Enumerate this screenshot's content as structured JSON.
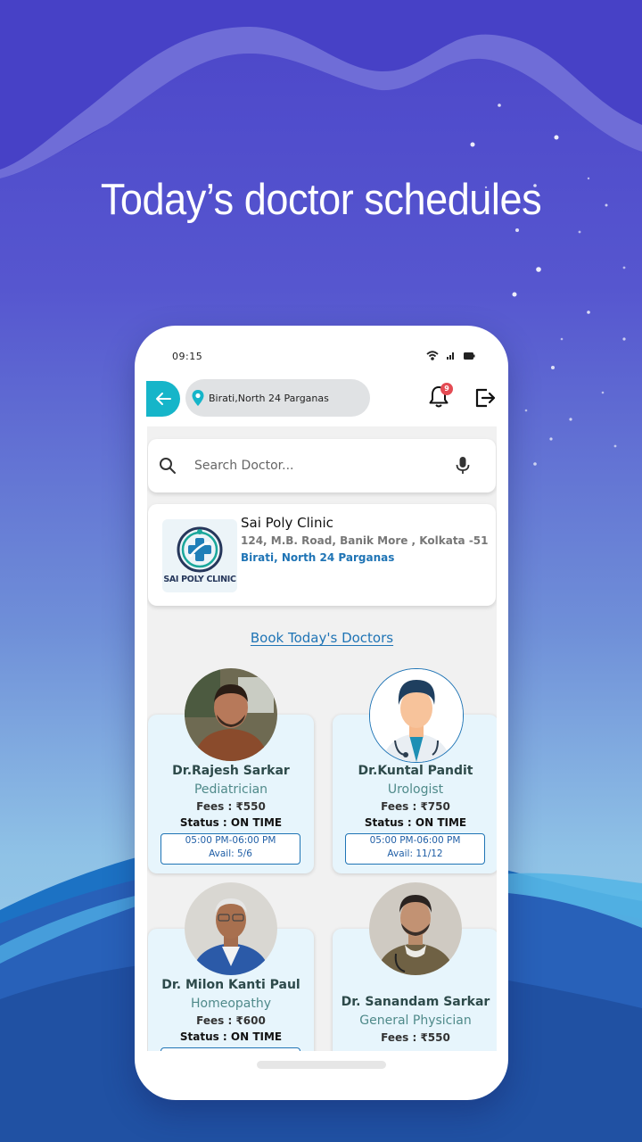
{
  "headline": "Today’s doctor schedules",
  "phone": {
    "status_time": "09:15",
    "status_icons": [
      "wifi-icon",
      "signal-icon",
      "battery-icon"
    ]
  },
  "topbar": {
    "back_icon": "arrow-left-icon",
    "location": "Birati,North 24 Parganas",
    "notification_count": "9"
  },
  "search": {
    "placeholder": "Search Doctor..."
  },
  "clinic": {
    "logo_text": "SAI POLY CLINIC",
    "name": "Sai Poly Clinic",
    "address": "124, M.B. Road, Banik More , Kolkata -51",
    "area": "Birati, North 24 Parganas"
  },
  "book_link": "Book Today's Doctors",
  "doctors": [
    {
      "name": "Dr.Rajesh Sarkar",
      "specialty": "Pediatrician",
      "fees": "Fees : ₹550",
      "status": "Status : ON TIME",
      "time": "05:00 PM-06:00 PM",
      "avail": "Avail: 5/6"
    },
    {
      "name": "Dr.Kuntal Pandit",
      "specialty": "Urologist",
      "fees": "Fees : ₹750",
      "status": "Status : ON TIME",
      "time": "05:00 PM-06:00 PM",
      "avail": "Avail: 11/12"
    },
    {
      "name": "Dr. Milon Kanti Paul",
      "specialty": "Homeopathy",
      "fees": "Fees : ₹600",
      "status": "Status : ON TIME"
    },
    {
      "name": "Dr. Sanandam Sarkar",
      "specialty": "General Physician",
      "fees": "Fees : ₹550"
    }
  ],
  "colors": {
    "accent": "#16b5c9",
    "link": "#1f74b5",
    "card_bg": "#e7f5fc",
    "badge": "#e44c54"
  }
}
